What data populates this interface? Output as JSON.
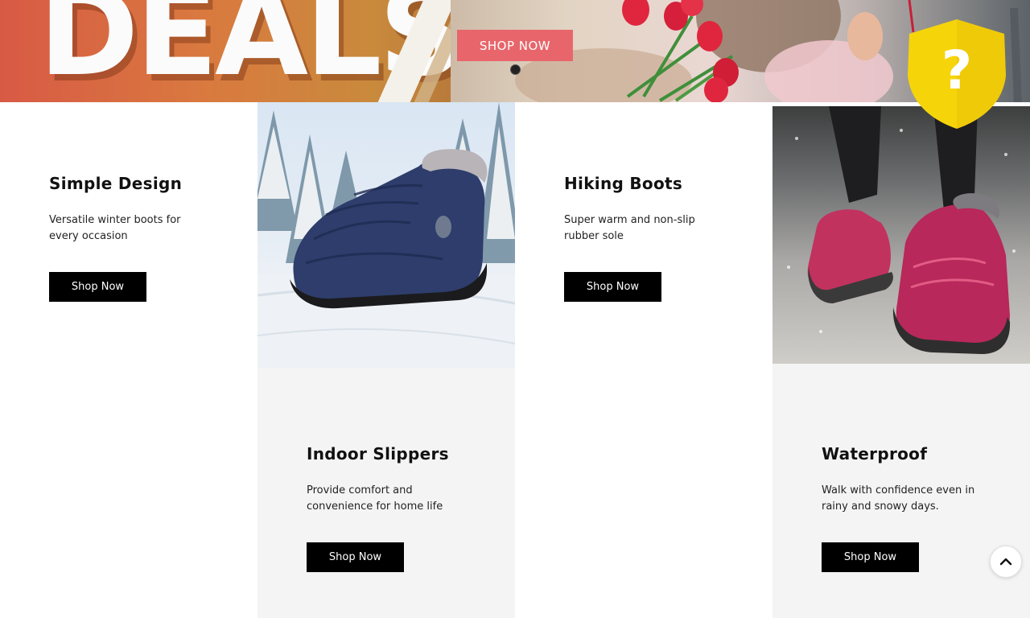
{
  "hero": {
    "title": "DEALS",
    "cta_label": "SHOP NOW",
    "slide_count": 1,
    "active_slide": 1
  },
  "badge": {
    "icon": "question-shield-icon",
    "symbol": "?"
  },
  "cards": [
    {
      "title": "Simple Design",
      "description": "Versatile winter boots for every occasion",
      "button": "Shop Now"
    },
    {
      "title": "Hiking Boots",
      "description": "Super warm and non-slip rubber sole",
      "button": "Shop Now"
    },
    {
      "title": "Indoor Slippers",
      "description": "Provide comfort and convenience for home life",
      "button": "Shop Now"
    },
    {
      "title": "Waterproof",
      "description": "Walk with confidence even in rainy and snowy days.",
      "button": "Shop Now"
    }
  ],
  "images": [
    {
      "icon": "navy-snow-boot-image"
    },
    {
      "icon": "pink-hiking-shoe-image"
    }
  ],
  "scroll_top": {
    "icon": "chevron-up-icon"
  },
  "colors": {
    "cta_bg": "#e8666b",
    "button_bg": "#000000",
    "badge_yellow": "#f6d40a",
    "grey_cell": "#f4f4f4"
  }
}
